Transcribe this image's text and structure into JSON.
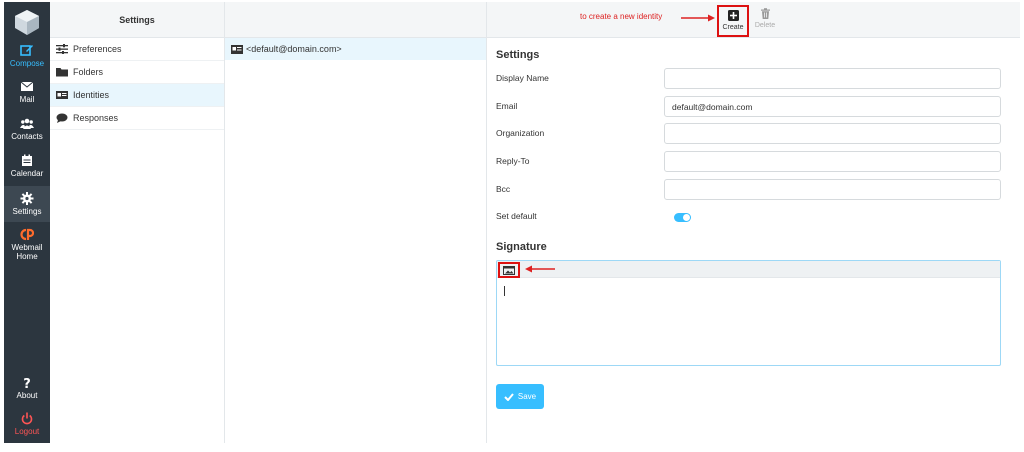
{
  "rail": {
    "items": [
      {
        "label": "Compose"
      },
      {
        "label": "Mail"
      },
      {
        "label": "Contacts"
      },
      {
        "label": "Calendar"
      },
      {
        "label": "Settings"
      },
      {
        "label": "Webmail Home"
      },
      {
        "label": "About"
      },
      {
        "label": "Logout"
      }
    ]
  },
  "settings_panel": {
    "title": "Settings",
    "items": [
      {
        "label": "Preferences",
        "icon": "sliders-icon"
      },
      {
        "label": "Folders",
        "icon": "folder-icon"
      },
      {
        "label": "Identities",
        "icon": "id-card-icon"
      },
      {
        "label": "Responses",
        "icon": "comment-icon"
      }
    ]
  },
  "identities": {
    "rows": [
      {
        "label": "<default@domain.com>"
      }
    ]
  },
  "toolbar": {
    "annotation": "to create a new identity",
    "create_label": "Create",
    "delete_label": "Delete"
  },
  "form": {
    "title": "Settings",
    "fields": [
      {
        "label": "Display Name",
        "value": ""
      },
      {
        "label": "Email",
        "value": "default@domain.com"
      },
      {
        "label": "Organization",
        "value": ""
      },
      {
        "label": "Reply-To",
        "value": ""
      },
      {
        "label": "Bcc",
        "value": ""
      }
    ],
    "set_default_label": "Set default",
    "set_default_on": true,
    "signature_title": "Signature",
    "save_label": "Save"
  },
  "colors": {
    "accent": "#37beff",
    "rail": "#2c363f",
    "annotation": "#dd2222"
  }
}
